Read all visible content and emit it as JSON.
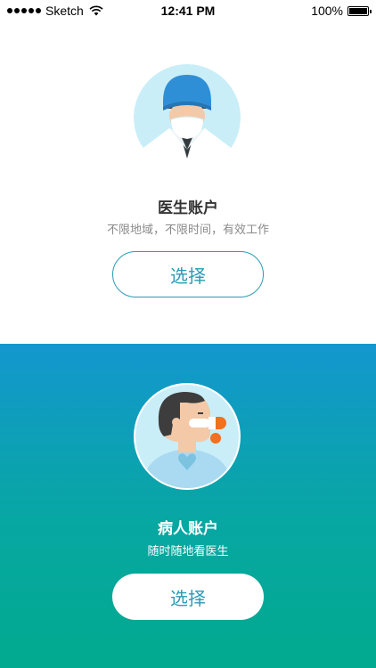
{
  "status_bar": {
    "carrier": "Sketch",
    "time": "12:41 PM",
    "battery": "100%",
    "signal_icon": "signal-dots-icon",
    "wifi_icon": "wifi-icon",
    "battery_icon": "battery-icon"
  },
  "doctor": {
    "title": "医生账户",
    "subtitle": "不限地域，不限时间，有效工作",
    "button_label": "选择",
    "avatar_icon": "doctor-avatar-icon"
  },
  "patient": {
    "title": "病人账户",
    "subtitle": "随时随地看医生",
    "button_label": "选择",
    "avatar_icon": "patient-avatar-icon"
  },
  "colors": {
    "accent": "#2a9bb5",
    "gradient_top": "#1497cf",
    "gradient_bottom": "#02aa8f",
    "avatar_bg": "#c9eef8"
  }
}
